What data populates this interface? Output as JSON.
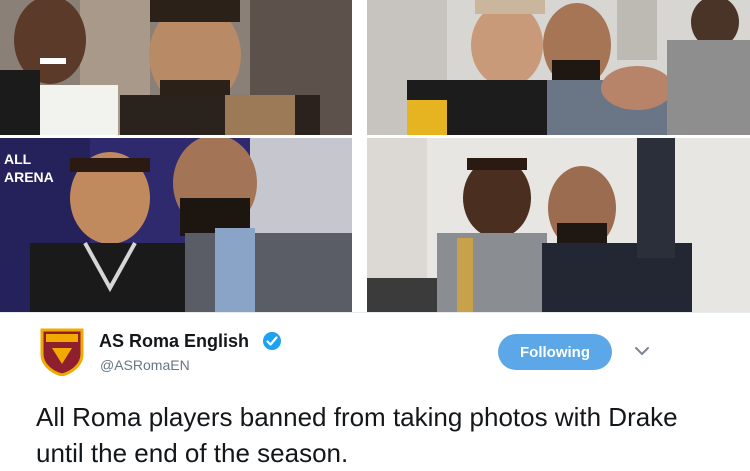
{
  "photos": [
    {
      "label": "photo-top-left"
    },
    {
      "label": "photo-top-right"
    },
    {
      "label": "photo-bottom-left",
      "wall_text": "ARENA",
      "wall_text2": "ALL"
    },
    {
      "label": "photo-bottom-right"
    }
  ],
  "tweet": {
    "account_name": "AS Roma English",
    "handle": "@ASRomaEN",
    "follow_label": "Following",
    "text": "All Roma players banned from taking photos with Drake until the end of the season.",
    "colors": {
      "follow_button": "#5ba7e8",
      "verified_badge": "#1da1f2",
      "crest_red": "#8e1f2f",
      "crest_gold": "#f2a900"
    }
  }
}
